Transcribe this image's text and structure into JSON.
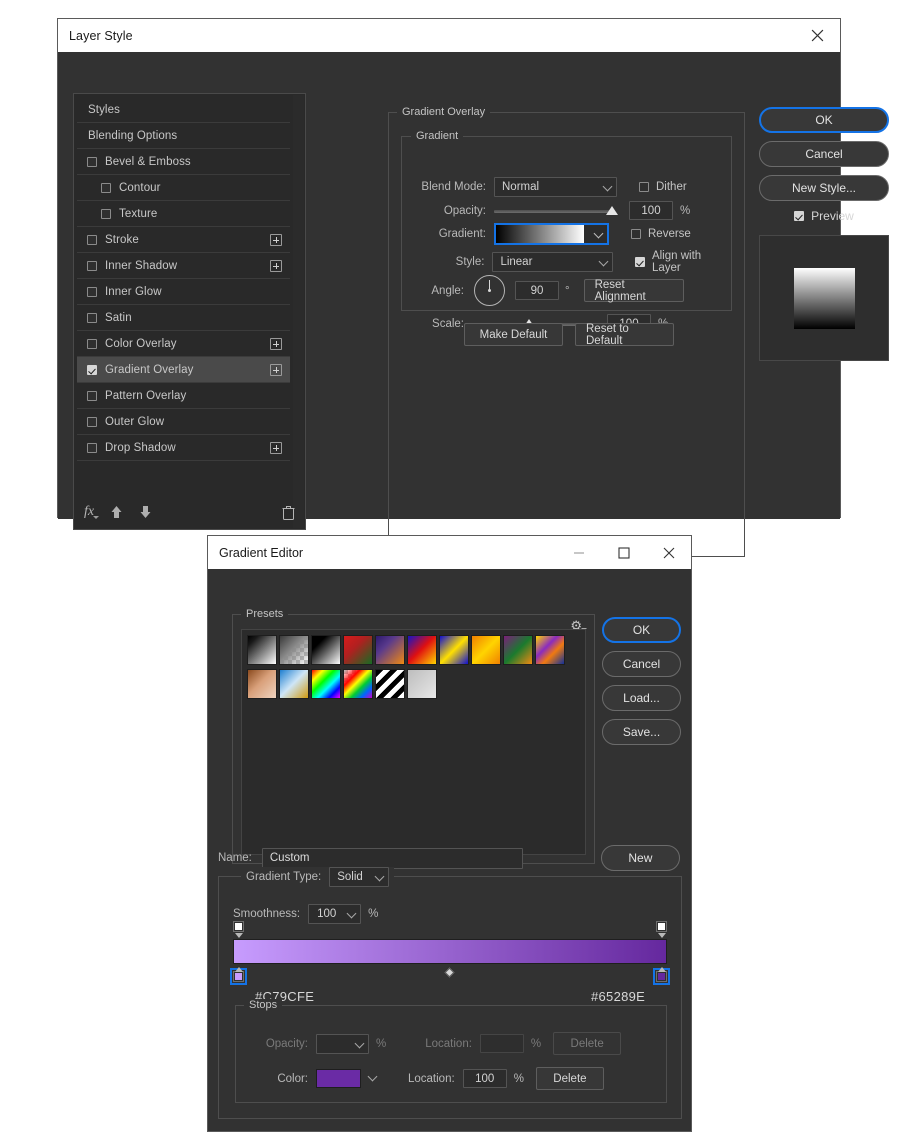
{
  "layer_style": {
    "title": "Layer Style",
    "close_icon": "close-icon",
    "styles": [
      {
        "label": "Styles",
        "type": "plain"
      },
      {
        "label": "Blending Options",
        "type": "plain"
      },
      {
        "label": "Bevel & Emboss",
        "type": "check",
        "checked": false,
        "plus": false
      },
      {
        "label": "Contour",
        "type": "check",
        "sub": true,
        "checked": false
      },
      {
        "label": "Texture",
        "type": "check",
        "sub": true,
        "checked": false
      },
      {
        "label": "Stroke",
        "type": "check",
        "checked": false,
        "plus": true
      },
      {
        "label": "Inner Shadow",
        "type": "check",
        "checked": false,
        "plus": true
      },
      {
        "label": "Inner Glow",
        "type": "check",
        "checked": false
      },
      {
        "label": "Satin",
        "type": "check",
        "checked": false
      },
      {
        "label": "Color Overlay",
        "type": "check",
        "checked": false,
        "plus": true
      },
      {
        "label": "Gradient Overlay",
        "type": "check",
        "checked": true,
        "plus": true,
        "selected": true
      },
      {
        "label": "Pattern Overlay",
        "type": "check",
        "checked": false
      },
      {
        "label": "Outer Glow",
        "type": "check",
        "checked": false
      },
      {
        "label": "Drop Shadow",
        "type": "check",
        "checked": false,
        "plus": true
      }
    ],
    "footer_icons": [
      "fx-icon",
      "arrow-up-icon",
      "arrow-down-icon",
      "trash-icon"
    ],
    "panel": {
      "legend": "Gradient Overlay",
      "gradient_legend": "Gradient",
      "blend_mode_label": "Blend Mode:",
      "blend_mode_value": "Normal",
      "dither_label": "Dither",
      "dither_checked": false,
      "opacity_label": "Opacity:",
      "opacity_value": "100",
      "opacity_unit": "%",
      "gradient_label": "Gradient:",
      "gradient_from": "#000000",
      "gradient_to": "#ffffff",
      "reverse_label": "Reverse",
      "reverse_checked": false,
      "style_label": "Style:",
      "style_value": "Linear",
      "align_label": "Align with Layer",
      "align_checked": true,
      "angle_label": "Angle:",
      "angle_value": "90",
      "angle_unit": "°",
      "reset_alignment_label": "Reset Alignment",
      "scale_label": "Scale:",
      "scale_value": "100",
      "scale_unit": "%",
      "make_default_label": "Make Default",
      "reset_default_label": "Reset to Default"
    },
    "buttons": {
      "ok": "OK",
      "cancel": "Cancel",
      "new_style": "New Style...",
      "preview_label": "Preview",
      "preview_checked": true
    }
  },
  "gradient_editor": {
    "title": "Gradient Editor",
    "window_buttons": [
      "minimize-icon",
      "maximize-icon",
      "close-icon"
    ],
    "presets_legend": "Presets",
    "gear_icon": "gear-icon",
    "presets": [
      {
        "name": "foreground-to-background",
        "css": "linear-gradient(135deg,#000000 0%,#1a1a1a 18%,#ffffff 100%)"
      },
      {
        "name": "foreground-to-transparent",
        "css": "linear-gradient(135deg,#3a3a3a 0%,#8a8a8a 45%,rgba(200,200,200,0) 100%)"
      },
      {
        "name": "black-white",
        "css": "linear-gradient(135deg,#000000 0%,#000000 25%,#ffffff 100%)"
      },
      {
        "name": "red-green",
        "css": "linear-gradient(135deg,#d81b1b 0%,#b02020 40%,#166b23 100%)"
      },
      {
        "name": "violet-orange",
        "css": "linear-gradient(135deg,#2d1a6e 0%,#5a3a8c 35%,#f08a12 100%)"
      },
      {
        "name": "blue-red-yellow",
        "css": "linear-gradient(135deg,#1414c8 0%,#e01010 48%,#ffd400 100%)"
      },
      {
        "name": "blue-yellow-blue",
        "css": "linear-gradient(135deg,#0f0fd2 0%,#ffe000 50%,#0f0fd2 100%)"
      },
      {
        "name": "orange-yellow-orange",
        "css": "linear-gradient(135deg,#f08000 0%,#ffd400 50%,#f08000 100%)"
      },
      {
        "name": "violet-green-orange",
        "css": "linear-gradient(135deg,#7a1f7a 0%,#1a7a2e 50%,#f08a12 100%)"
      },
      {
        "name": "yellow-violet-orange-blue",
        "css": "linear-gradient(135deg,#ffd400 0%,#8a2bbf 38%,#f07a10 62%,#10309a 100%)"
      },
      {
        "name": "copper",
        "css": "linear-gradient(135deg,#8a4a1e 0%,#d9a07a 45%,#efd4c0 100%)"
      },
      {
        "name": "chrome",
        "css": "linear-gradient(135deg,#1f7fd0 0%,#cfe6f7 48%,#d09a10 100%)"
      },
      {
        "name": "spectrum",
        "css": "linear-gradient(135deg,#ff0000 0%,#ffff00 20%,#00ff00 40%,#00ffff 60%,#0000ff 80%,#ff00ff 100%)"
      },
      {
        "name": "transparent-rainbow",
        "css": "linear-gradient(135deg,rgba(255,255,255,0) 0%,#ff0000 28%,#ffff00 45%,#00cc33 62%,#0066ff 80%,#cc00cc 100%)"
      },
      {
        "name": "transparent-stripes",
        "css": "repeating-linear-gradient(135deg,#000 0 5px,#fff 5px 10px)"
      },
      {
        "name": "neutral-density",
        "css": "linear-gradient(135deg,#bdbdbd 0%,#d6d6d6 60%,#e8e8e8 100%)"
      }
    ],
    "buttons": {
      "ok": "OK",
      "cancel": "Cancel",
      "load": "Load...",
      "save": "Save...",
      "new": "New"
    },
    "name_label": "Name:",
    "name_value": "Custom",
    "gradient_type_label": "Gradient Type:",
    "gradient_type_value": "Solid",
    "smoothness_label": "Smoothness:",
    "smoothness_value": "100",
    "smoothness_unit": "%",
    "gradient_bar": {
      "start_color": "#C79CFE",
      "end_color": "#65289E",
      "start_hex_label": "#C79CFE",
      "end_hex_label": "#65289E",
      "midpoint_location": 50
    },
    "stops_legend": "Stops",
    "stops": {
      "opacity_label": "Opacity:",
      "opacity_value": "",
      "opacity_unit": "%",
      "opacity_location_label": "Location:",
      "opacity_location_value": "",
      "opacity_location_unit": "%",
      "opacity_delete_label": "Delete",
      "color_label": "Color:",
      "color_value": "#6A2BA5",
      "color_location_label": "Location:",
      "color_location_value": "100",
      "color_location_unit": "%",
      "color_delete_label": "Delete"
    }
  }
}
